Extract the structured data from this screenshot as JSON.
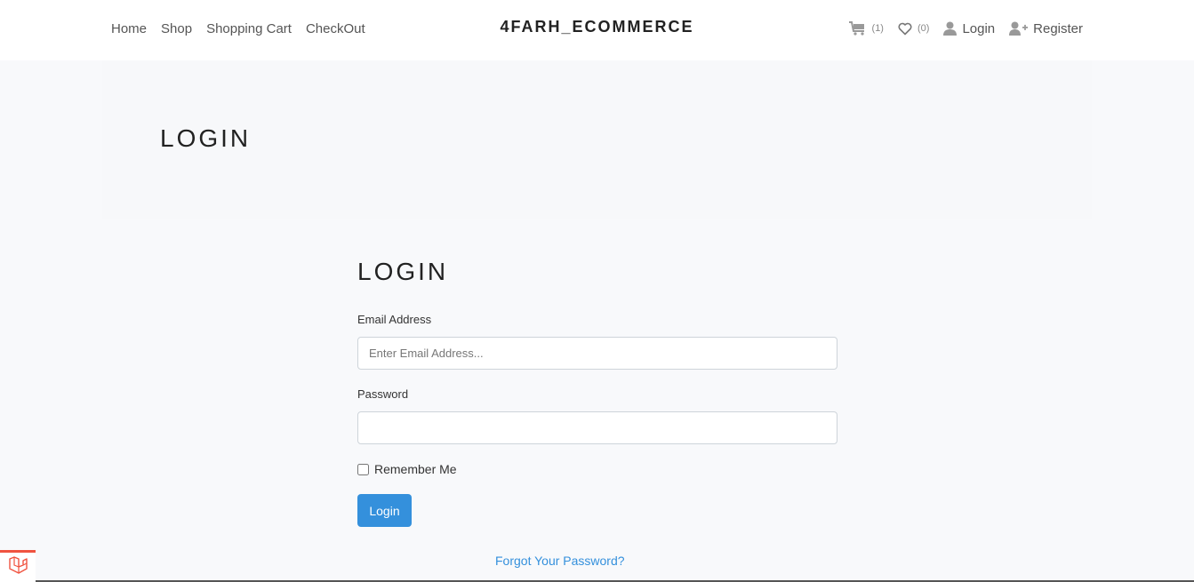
{
  "nav": {
    "links": [
      "Home",
      "Shop",
      "Shopping Cart",
      "CheckOut"
    ],
    "brand": "4FARH_ECOMMERCE",
    "cart_count": "(1)",
    "wishlist_count": "(0)",
    "login_label": "Login",
    "register_label": "Register",
    "icons": [
      "cart-icon",
      "heart-icon",
      "user-icon",
      "user-plus-icon"
    ]
  },
  "hero": {
    "title": "LOGIN"
  },
  "form": {
    "title": "LOGIN",
    "email_label": "Email Address",
    "email_placeholder": "Enter Email Address...",
    "email_value": "",
    "password_label": "Password",
    "password_value": "",
    "remember_label": "Remember Me",
    "remember_checked": false,
    "submit_label": "Login",
    "forgot_label": "Forgot Your Password?"
  },
  "colors": {
    "accent": "#3490dc",
    "page_bg": "#f8f9fb",
    "laravel_red": "#f05340"
  }
}
